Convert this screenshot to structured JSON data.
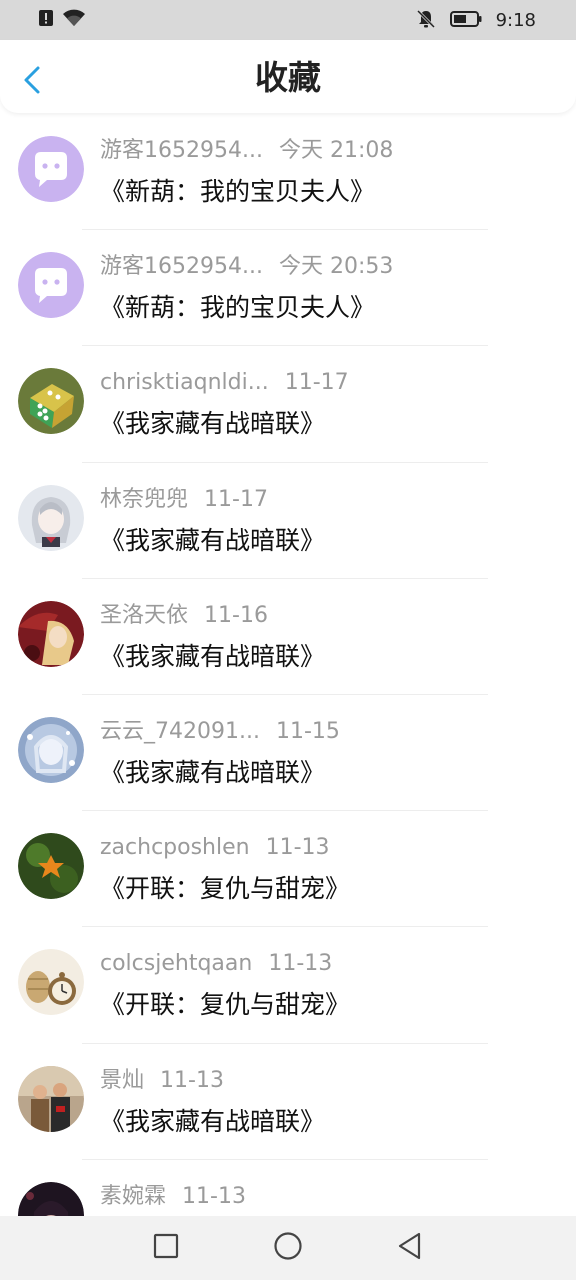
{
  "status_bar": {
    "time": "9:18"
  },
  "header": {
    "title": "收藏"
  },
  "items": [
    {
      "name": "游客1652954...",
      "time": "今天 21:08",
      "book": "《新葫：我的宝贝夫人》",
      "avatar": "default"
    },
    {
      "name": "游客1652954...",
      "time": "今天 20:53",
      "book": "《新葫：我的宝贝夫人》",
      "avatar": "default"
    },
    {
      "name": "chrisktiaqnldi...",
      "time": "11-17",
      "book": "《我家藏有战暗联》",
      "avatar": "dice"
    },
    {
      "name": "林奈兜兜",
      "time": "11-17",
      "book": "《我家藏有战暗联》",
      "avatar": "anime-girl"
    },
    {
      "name": "圣洛天依",
      "time": "11-16",
      "book": "《我家藏有战暗联》",
      "avatar": "red-portrait"
    },
    {
      "name": "云云_742091...",
      "time": "11-15",
      "book": "《我家藏有战暗联》",
      "avatar": "blue-anime"
    },
    {
      "name": "zachcposhlen",
      "time": "11-13",
      "book": "《开联：复仇与甜宠》",
      "avatar": "leaf"
    },
    {
      "name": "colcsjehtqaan",
      "time": "11-13",
      "book": "《开联：复仇与甜宠》",
      "avatar": "clock"
    },
    {
      "name": "景灿",
      "time": "11-13",
      "book": "《我家藏有战暗联》",
      "avatar": "couple"
    },
    {
      "name": "素婉霖",
      "time": "11-13",
      "book": "",
      "avatar": "dark"
    }
  ]
}
